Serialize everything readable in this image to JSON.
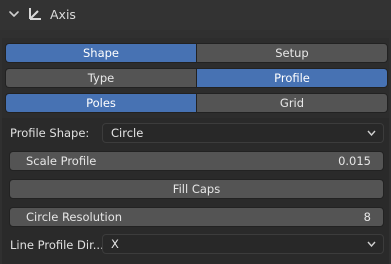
{
  "header": {
    "title": "Axis",
    "icon": "axis-empty-icon",
    "expanded": true
  },
  "tabs_main": [
    {
      "label": "Shape",
      "active": true
    },
    {
      "label": "Setup",
      "active": false
    }
  ],
  "tabs_sub": [
    {
      "label": "Type",
      "active": false
    },
    {
      "label": "Profile",
      "active": true
    }
  ],
  "tabs_mode": [
    {
      "label": "Poles",
      "active": true
    },
    {
      "label": "Grid",
      "active": false
    }
  ],
  "profile_shape": {
    "label": "Profile Shape:",
    "value": "Circle"
  },
  "scale_profile": {
    "label": "Scale Profile",
    "value": "0.015"
  },
  "fill_caps": {
    "label": "Fill Caps"
  },
  "circle_resolution": {
    "label": "Circle Resolution",
    "value": "8"
  },
  "line_profile_dir": {
    "label": "Line Profile Dir...",
    "value": "X"
  },
  "colors": {
    "accent": "#4772b3",
    "widget": "#545454",
    "background": "#303030"
  }
}
